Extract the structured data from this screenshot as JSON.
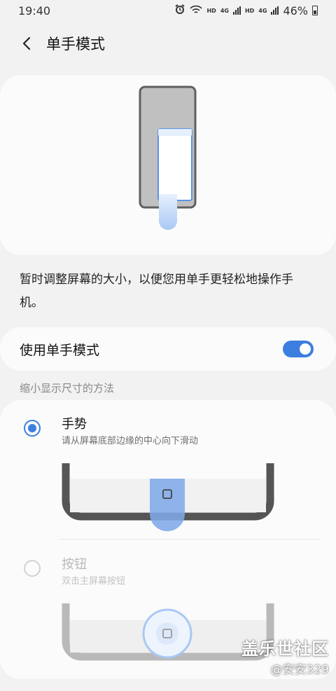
{
  "status_bar": {
    "time": "19:40",
    "net1": "HD",
    "net1_type": "4G",
    "net2": "HD",
    "net2_type": "4G",
    "battery": "46%"
  },
  "header": {
    "title": "单手模式"
  },
  "description": "暂时调整屏幕的大小，以便您用单手更轻松地操作手机。",
  "toggle": {
    "label": "使用单手模式",
    "on": true
  },
  "section": {
    "label": "缩小显示尺寸的方法"
  },
  "options": [
    {
      "title": "手势",
      "subtitle": "请从屏幕底部边缘的中心向下滑动",
      "selected": true
    },
    {
      "title": "按钮",
      "subtitle": "双击主屏幕按钮",
      "selected": false
    }
  ],
  "watermark": {
    "main": "盖乐世社区",
    "sub": "@安安329"
  },
  "colors": {
    "accent": "#3c7fe0",
    "background": "#f2f2f2",
    "card": "#fbfbfb"
  }
}
